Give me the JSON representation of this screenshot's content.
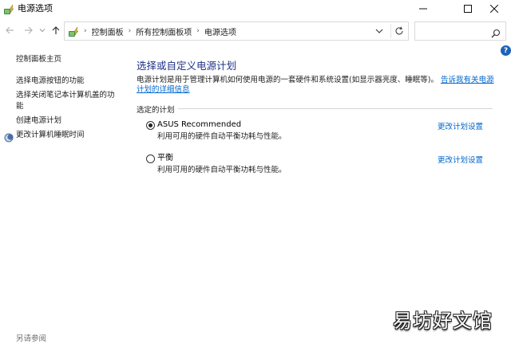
{
  "window": {
    "title": "电源选项"
  },
  "address_bar": {
    "crumbs": [
      "控制面板",
      "所有控制面板项",
      "电源选项"
    ],
    "search_placeholder": ""
  },
  "sidebar": {
    "home": "控制面板主页",
    "links": {
      "power_button": "选择电源按钮的功能",
      "lid_line1": "选择关闭笔记本计算机盖的功",
      "lid_line2": "能",
      "create_plan": "创建电源计划",
      "sleep_time": "更改计算机睡眠时间"
    },
    "see_also": "另请参阅"
  },
  "main": {
    "title": "选择或自定义电源计划",
    "description": "电源计划是用于管理计算机如何使用电源的一套硬件和系统设置(如显示器亮度、睡眠等)。",
    "description_link": "告诉我有关电源计划的详细信息",
    "group_label": "选定的计划",
    "plans": [
      {
        "name": "ASUS Recommended",
        "description": "利用可用的硬件自动平衡功耗与性能。",
        "link": "更改计划设置",
        "selected": true
      },
      {
        "name": "平衡",
        "description": "利用可用的硬件自动平衡功耗与性能。",
        "link": "更改计划设置",
        "selected": false
      }
    ],
    "help": "?"
  },
  "watermark": "易坊好文馆",
  "colors": {
    "title_blue": "#1e3287",
    "link_blue": "#0066cc",
    "help_blue": "#1c63b7"
  }
}
